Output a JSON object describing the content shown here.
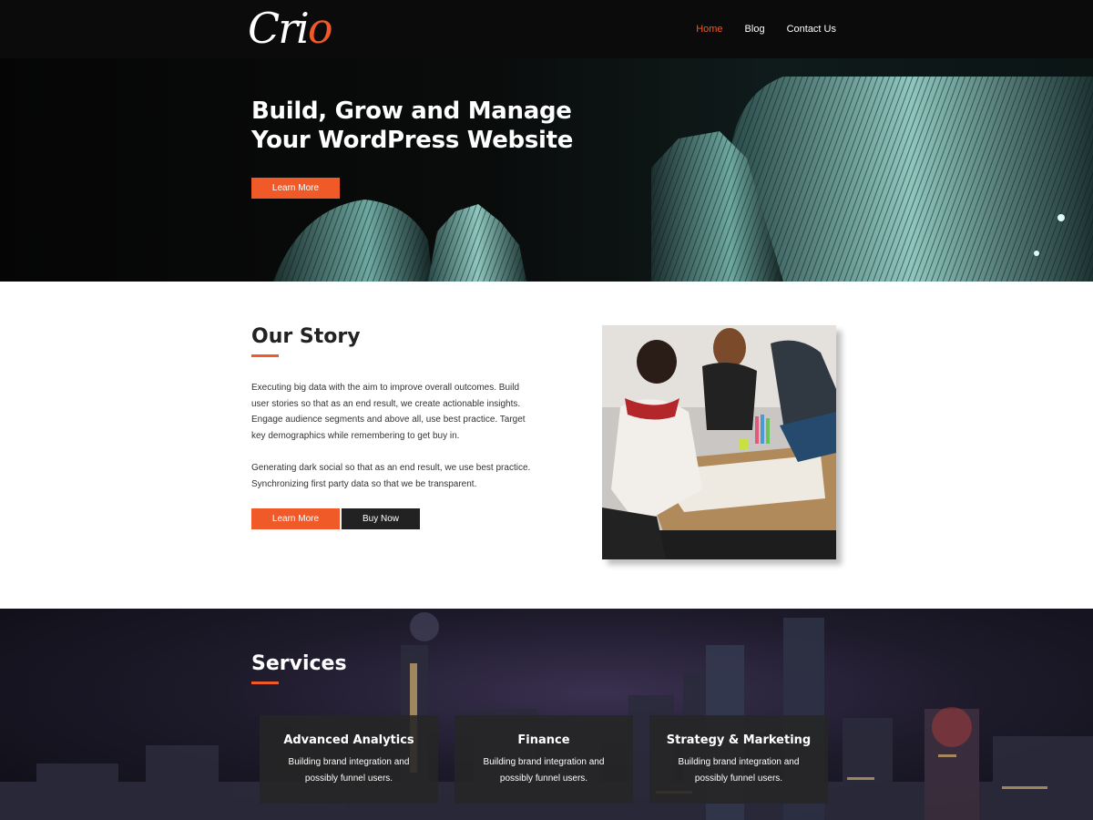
{
  "header": {
    "logo_text": "Cri",
    "logo_accent": "o",
    "nav": [
      {
        "label": "Home",
        "active": true
      },
      {
        "label": "Blog",
        "active": false
      },
      {
        "label": "Contact Us",
        "active": false
      }
    ]
  },
  "hero": {
    "title_line1": "Build, Grow and Manage",
    "title_line2": "Your WordPress Website",
    "button_label": "Learn More"
  },
  "story": {
    "title": "Our Story",
    "paragraph1": "Executing big data with the aim to improve overall outcomes. Build user stories so that as an end result, we create actionable insights. Engage audience segments and above all, use best practice. Target key demographics while remembering to get buy in.",
    "paragraph2": "Generating dark social so that as an end result, we use best practice. Synchronizing first party data so that we be transparent.",
    "button_primary": "Learn More",
    "button_secondary": "Buy Now"
  },
  "services": {
    "title": "Services",
    "cards": [
      {
        "title": "Advanced Analytics",
        "text": "Building brand integration and possibly funnel users."
      },
      {
        "title": "Finance",
        "text": "Building brand integration and possibly funnel users."
      },
      {
        "title": "Strategy & Marketing",
        "text": "Building brand integration and possibly funnel users."
      }
    ]
  },
  "colors": {
    "accent": "#f05a28",
    "header_bg": "#0b0b0b",
    "dark_button": "#222222"
  }
}
